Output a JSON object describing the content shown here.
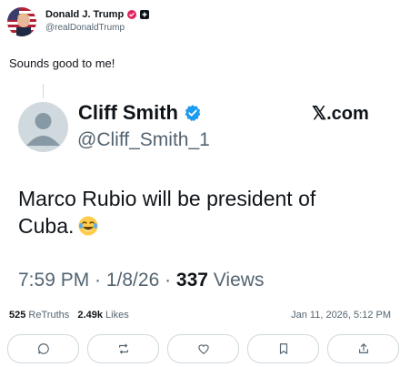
{
  "author": {
    "name": "Donald J. Trump",
    "handle": "@realDonaldTrump"
  },
  "post": {
    "text": "Sounds good to me!"
  },
  "quoted": {
    "name": "Cliff Smith",
    "handle": "@Cliff_Smith_1",
    "source": "𝕏.com",
    "body": "Marco Rubio will be president of Cuba.",
    "time": "7:59 PM · 1/8/26 · ",
    "views_count": "337",
    "views_label": " Views"
  },
  "stats": {
    "retruths_count": "525",
    "retruths_label": "ReTruths",
    "likes_count": "2.49k",
    "likes_label": "Likes",
    "date": "Jan 11, 2026, 5:12 PM"
  },
  "actions": {
    "icons": [
      "reply-icon",
      "retruth-icon",
      "like-icon",
      "bookmark-icon",
      "share-icon"
    ]
  },
  "colors": {
    "badge": "#e0245e",
    "verified": "#1d9bf0",
    "muted": "#536471"
  }
}
